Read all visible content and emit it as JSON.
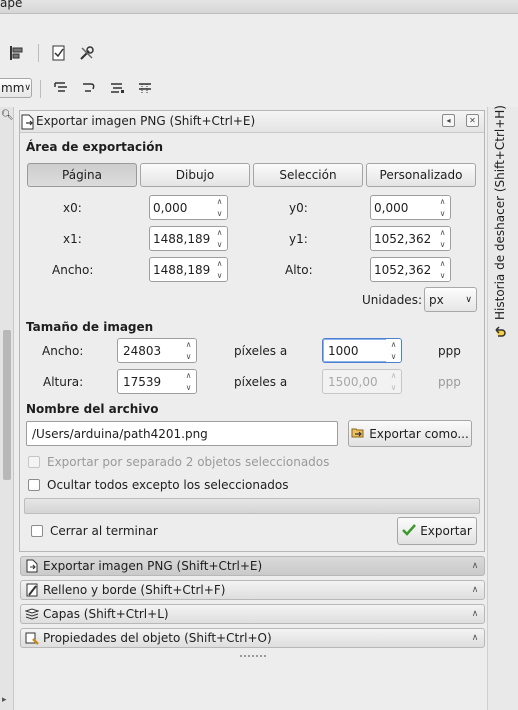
{
  "window": {
    "title_fragment": "ape"
  },
  "toolbar": {
    "unit_combo": "mm"
  },
  "right_dock": {
    "label": "Historia de deshacer (Shift+Ctrl+H)"
  },
  "export_panel": {
    "title": "Exportar imagen PNG (Shift+Ctrl+E)",
    "area": {
      "heading": "Área de exportación",
      "tabs": [
        "Página",
        "Dibujo",
        "Selección",
        "Personalizado"
      ],
      "active_tab": "Página",
      "x0_label": "x0:",
      "x0": "0,000",
      "y0_label": "y0:",
      "y0": "0,000",
      "x1_label": "x1:",
      "x1": "1488,189",
      "y1_label": "y1:",
      "y1": "1052,362",
      "width_label": "Ancho:",
      "width": "1488,189",
      "height_label": "Alto:",
      "height": "1052,362",
      "units_label": "Unidades:",
      "units": "px"
    },
    "image_size": {
      "heading": "Tamaño de imagen",
      "width_label": "Ancho:",
      "width": "24803",
      "height_label": "Altura:",
      "height": "17539",
      "pixels_at_1": "píxeles a",
      "pixels_at_2": "píxeles a",
      "dpi_x": "1000",
      "dpi_y": "1500,00",
      "dpi_unit_1": "ppp",
      "dpi_unit_2": "ppp"
    },
    "filename": {
      "heading": "Nombre del archivo",
      "value": "/Users/arduina/path4201.png",
      "export_as_label": "Exportar como..."
    },
    "options": {
      "batch_label": "Exportar por separado 2 objetos seleccionados",
      "hide_label": "Ocultar todos excepto los seleccionados",
      "close_label": "Cerrar al terminar"
    },
    "export_label": "Exportar"
  },
  "docked_dialogs": [
    {
      "label": "Exportar imagen PNG (Shift+Ctrl+E)",
      "icon": "export-png-icon"
    },
    {
      "label": "Relleno y borde (Shift+Ctrl+F)",
      "icon": "fill-stroke-icon"
    },
    {
      "label": "Capas (Shift+Ctrl+L)",
      "icon": "layers-icon"
    },
    {
      "label": "Propiedades del objeto (Shift+Ctrl+O)",
      "icon": "object-properties-icon"
    }
  ]
}
